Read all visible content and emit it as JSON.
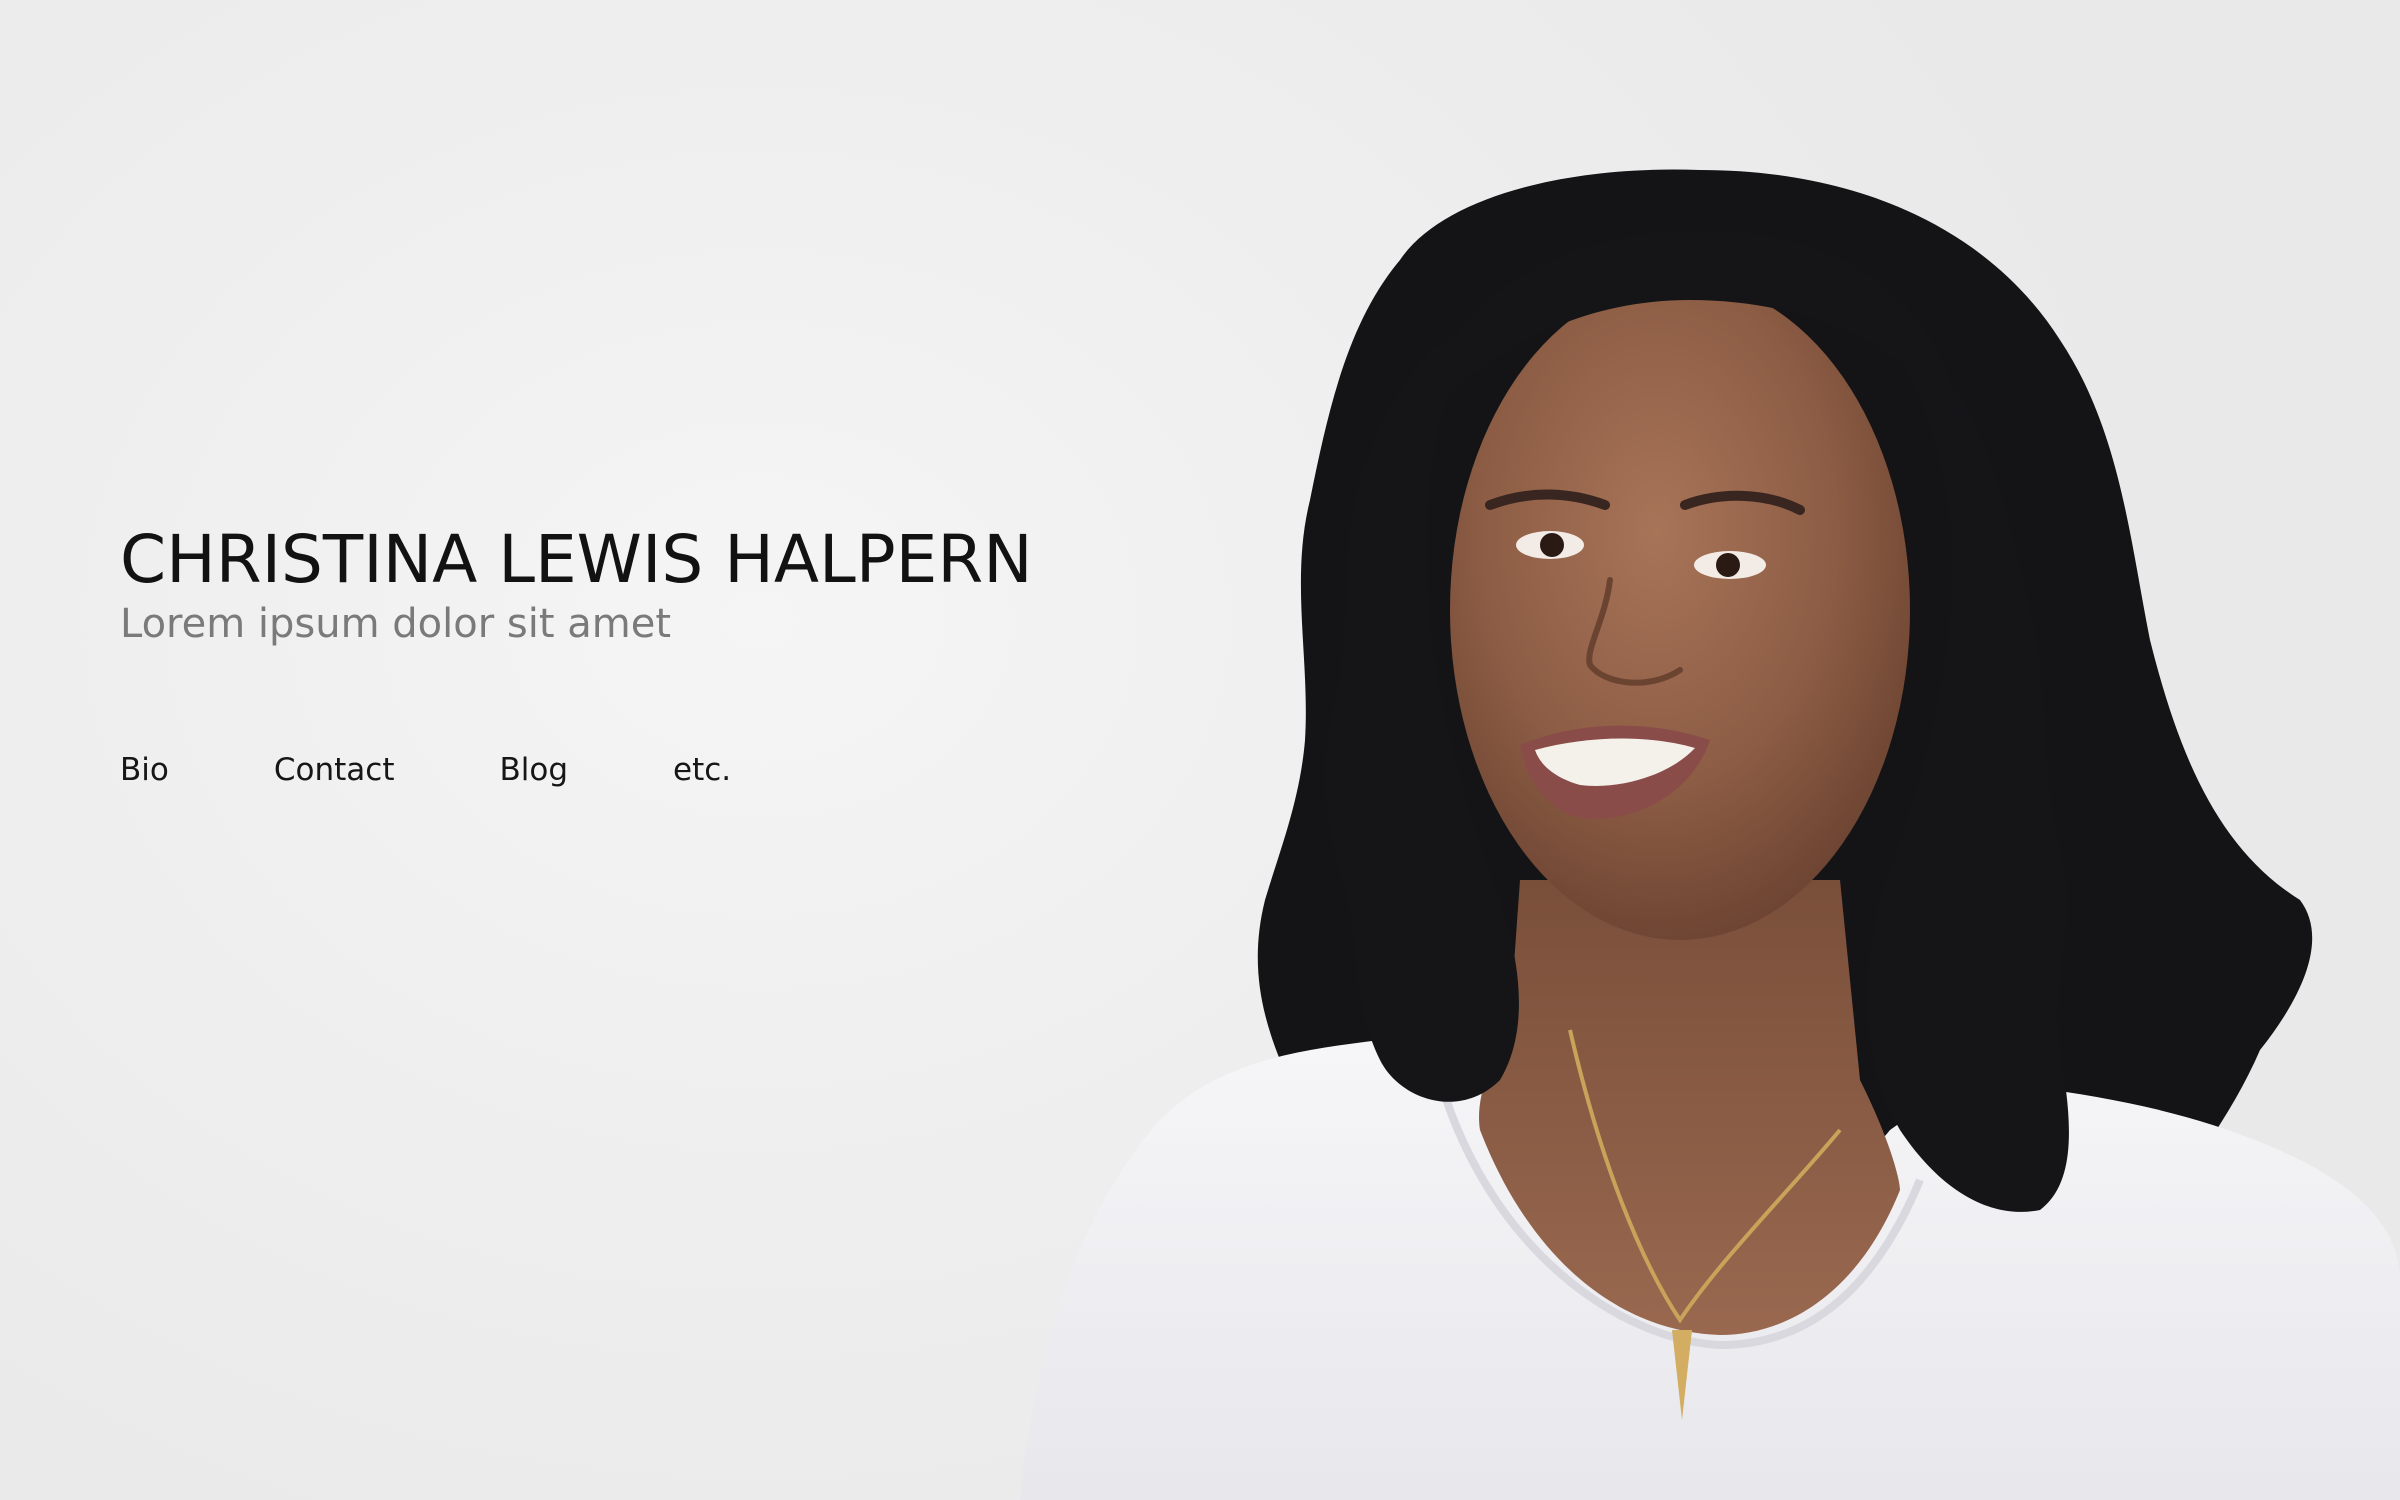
{
  "header": {
    "name": "CHRISTINA LEWIS HALPERN",
    "tagline": "Lorem ipsum dolor sit amet"
  },
  "nav": {
    "items": [
      {
        "label": "Bio"
      },
      {
        "label": "Contact"
      },
      {
        "label": "Blog"
      },
      {
        "label": "etc."
      }
    ]
  },
  "colors": {
    "background": "#ededed",
    "name_text": "#121212",
    "tagline_text": "#7a7a7a",
    "nav_text": "#161616",
    "hair": "#151518",
    "skin": "#8e5f48",
    "shirt": "#f3f3f6",
    "necklace": "#c9a35a"
  }
}
